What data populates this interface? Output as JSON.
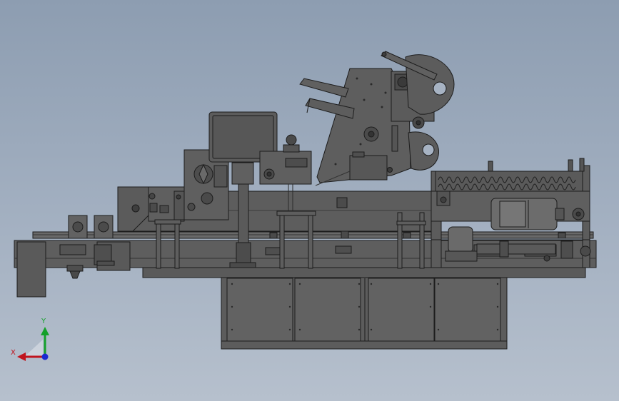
{
  "triad": {
    "x_label": "X",
    "y_label": "Y",
    "x_color": "#c0141e",
    "y_color": "#14a02a",
    "z_color": "#1a2ad0"
  },
  "colors": {
    "metal": "#5e5e5e",
    "metal_dark": "#474747",
    "metal_light": "#6c6c6c",
    "edge": "#1c1c1c",
    "background_top": "#8d9db1",
    "background_bottom": "#b6c0cd"
  }
}
